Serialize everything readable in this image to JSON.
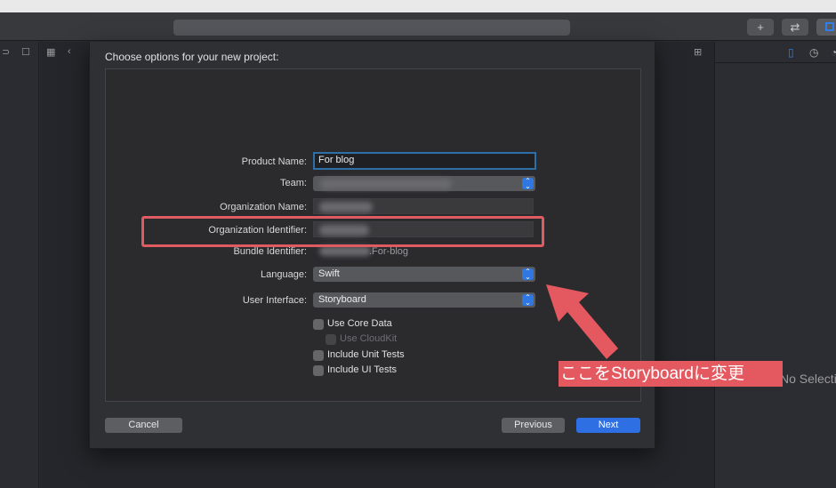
{
  "sheet": {
    "title": "Choose options for your new project:",
    "fields": {
      "product_name": {
        "label": "Product Name:",
        "value": "For blog"
      },
      "team": {
        "label": "Team:"
      },
      "org_name": {
        "label": "Organization Name:"
      },
      "org_identifier": {
        "label": "Organization Identifier:"
      },
      "bundle_identifier": {
        "label": "Bundle Identifier:",
        "value": ".For-blog"
      },
      "language": {
        "label": "Language:",
        "value": "Swift"
      },
      "user_interface": {
        "label": "User Interface:",
        "value": "Storyboard"
      }
    },
    "checkboxes": {
      "core_data": "Use Core Data",
      "cloudkit": "Use CloudKit",
      "unit_tests": "Include Unit Tests",
      "ui_tests": "Include UI Tests"
    },
    "buttons": {
      "cancel": "Cancel",
      "previous": "Previous",
      "next": "Next"
    }
  },
  "inspector": {
    "no_selection": "No Selection"
  },
  "annotation": {
    "text": "ここをStoryboardに変更"
  },
  "toolbar": {
    "add_glyph": "+",
    "swap_glyph": "⇄"
  },
  "colors": {
    "accent": "#2f6fe4",
    "annotation": "#e4595f"
  }
}
